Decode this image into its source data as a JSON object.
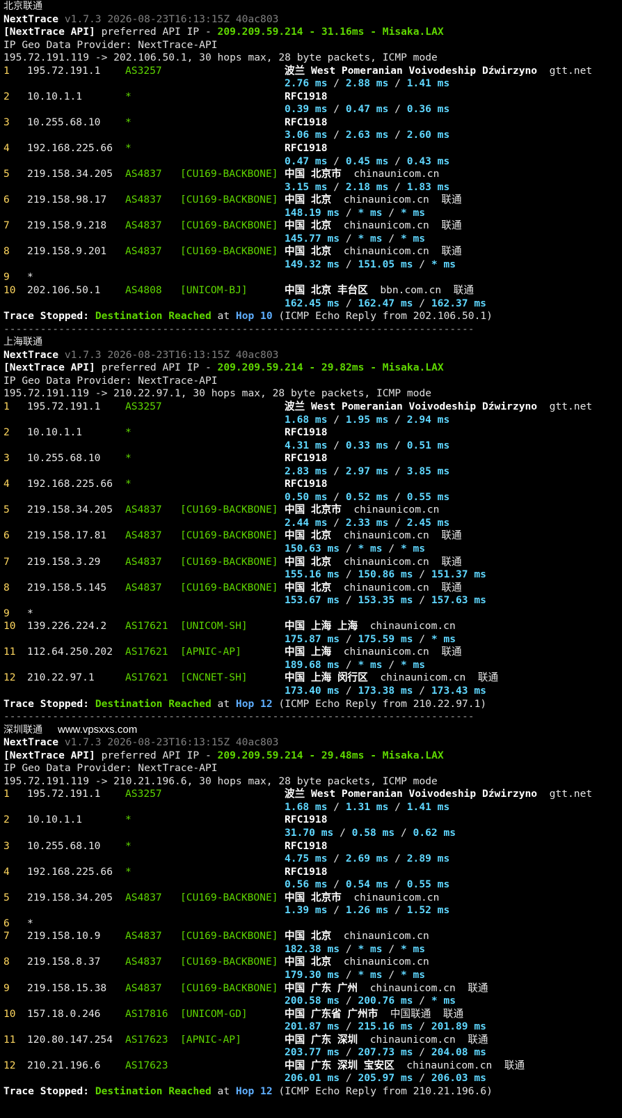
{
  "common": {
    "app_name": "NextTrace",
    "version_line": "v1.7.3 2026-08-23T16:13:15Z 40ac803",
    "api_label": "[NextTrace API]",
    "api_text": " preferred API IP - ",
    "api_ip": "209.209.59.214",
    "dash": " - ",
    "api_node": "Misaka.LAX",
    "geo_provider": "IP Geo Data Provider: NextTrace-API",
    "stop_label": "Trace Stopped:",
    "stop_dest": "Destination Reached",
    "stop_at": " at ",
    "divider": "-----------------------------------------------------------------------------",
    "rtt_sep": " / "
  },
  "watermark": "www.vpsxxs.com",
  "sections": [
    {
      "title": "北京联通",
      "latency": "31.16ms",
      "header": "195.72.191.119 -> 202.106.50.1, 30 hops max, 28 byte packets, ICMP mode",
      "hops": [
        {
          "n": "1",
          "ip": "195.72.191.1",
          "asn": "AS3257",
          "tag": "",
          "geo": "波兰 West Pomeranian Voivodeship Dźwirzyno",
          "domain": "gtt.net",
          "isp": "",
          "rtt": [
            "2.76 ms",
            "2.88 ms",
            "1.41 ms"
          ]
        },
        {
          "n": "2",
          "ip": "10.10.1.1",
          "asn": "*",
          "tag": "",
          "geo": "RFC1918",
          "domain": "",
          "isp": "",
          "rtt": [
            "0.39 ms",
            "0.47 ms",
            "0.36 ms"
          ]
        },
        {
          "n": "3",
          "ip": "10.255.68.10",
          "asn": "*",
          "tag": "",
          "geo": "RFC1918",
          "domain": "",
          "isp": "",
          "rtt": [
            "3.06 ms",
            "2.63 ms",
            "2.60 ms"
          ]
        },
        {
          "n": "4",
          "ip": "192.168.225.66",
          "asn": "*",
          "tag": "",
          "geo": "RFC1918",
          "domain": "",
          "isp": "",
          "rtt": [
            "0.47 ms",
            "0.45 ms",
            "0.43 ms"
          ]
        },
        {
          "n": "5",
          "ip": "219.158.34.205",
          "asn": "AS4837",
          "tag": "[CU169-BACKBONE]",
          "geo": "中国 北京市",
          "domain": "chinaunicom.cn",
          "isp": "",
          "rtt": [
            "3.15 ms",
            "2.18 ms",
            "1.83 ms"
          ]
        },
        {
          "n": "6",
          "ip": "219.158.98.17",
          "asn": "AS4837",
          "tag": "[CU169-BACKBONE]",
          "geo": "中国 北京",
          "domain": "chinaunicom.cn",
          "isp": "联通",
          "rtt": [
            "148.19 ms",
            "* ms",
            "* ms"
          ]
        },
        {
          "n": "7",
          "ip": "219.158.9.218",
          "asn": "AS4837",
          "tag": "[CU169-BACKBONE]",
          "geo": "中国 北京",
          "domain": "chinaunicom.cn",
          "isp": "联通",
          "rtt": [
            "145.77 ms",
            "* ms",
            "* ms"
          ]
        },
        {
          "n": "8",
          "ip": "219.158.9.201",
          "asn": "AS4837",
          "tag": "[CU169-BACKBONE]",
          "geo": "中国 北京",
          "domain": "chinaunicom.cn",
          "isp": "联通",
          "rtt": [
            "149.32 ms",
            "151.05 ms",
            "* ms"
          ]
        },
        {
          "n": "9",
          "ip": "*",
          "asn": "",
          "tag": "",
          "geo": "",
          "domain": "",
          "isp": "",
          "rtt": []
        },
        {
          "n": "10",
          "ip": "202.106.50.1",
          "asn": "AS4808",
          "tag": "[UNICOM-BJ]",
          "geo": "中国 北京 丰台区",
          "domain": "bbn.com.cn",
          "isp": "联通",
          "rtt": [
            "162.45 ms",
            "162.47 ms",
            "162.37 ms"
          ]
        }
      ],
      "stop_hop": "Hop 10",
      "stop_tail": " (ICMP Echo Reply from 202.106.50.1)"
    },
    {
      "title": "上海联通",
      "latency": "29.82ms",
      "header": "195.72.191.119 -> 210.22.97.1, 30 hops max, 28 byte packets, ICMP mode",
      "hops": [
        {
          "n": "1",
          "ip": "195.72.191.1",
          "asn": "AS3257",
          "tag": "",
          "geo": "波兰 West Pomeranian Voivodeship Dźwirzyno",
          "domain": "gtt.net",
          "isp": "",
          "rtt": [
            "1.68 ms",
            "1.95 ms",
            "2.94 ms"
          ]
        },
        {
          "n": "2",
          "ip": "10.10.1.1",
          "asn": "*",
          "tag": "",
          "geo": "RFC1918",
          "domain": "",
          "isp": "",
          "rtt": [
            "4.31 ms",
            "0.33 ms",
            "0.51 ms"
          ]
        },
        {
          "n": "3",
          "ip": "10.255.68.10",
          "asn": "*",
          "tag": "",
          "geo": "RFC1918",
          "domain": "",
          "isp": "",
          "rtt": [
            "2.83 ms",
            "2.97 ms",
            "3.85 ms"
          ]
        },
        {
          "n": "4",
          "ip": "192.168.225.66",
          "asn": "*",
          "tag": "",
          "geo": "RFC1918",
          "domain": "",
          "isp": "",
          "rtt": [
            "0.50 ms",
            "0.52 ms",
            "0.55 ms"
          ]
        },
        {
          "n": "5",
          "ip": "219.158.34.205",
          "asn": "AS4837",
          "tag": "[CU169-BACKBONE]",
          "geo": "中国 北京市",
          "domain": "chinaunicom.cn",
          "isp": "",
          "rtt": [
            "2.44 ms",
            "2.33 ms",
            "2.45 ms"
          ]
        },
        {
          "n": "6",
          "ip": "219.158.17.81",
          "asn": "AS4837",
          "tag": "[CU169-BACKBONE]",
          "geo": "中国 北京",
          "domain": "chinaunicom.cn",
          "isp": "联通",
          "rtt": [
            "150.63 ms",
            "* ms",
            "* ms"
          ]
        },
        {
          "n": "7",
          "ip": "219.158.3.29",
          "asn": "AS4837",
          "tag": "[CU169-BACKBONE]",
          "geo": "中国 北京",
          "domain": "chinaunicom.cn",
          "isp": "联通",
          "rtt": [
            "155.16 ms",
            "150.86 ms",
            "151.37 ms"
          ]
        },
        {
          "n": "8",
          "ip": "219.158.5.145",
          "asn": "AS4837",
          "tag": "[CU169-BACKBONE]",
          "geo": "中国 北京",
          "domain": "chinaunicom.cn",
          "isp": "联通",
          "rtt": [
            "153.67 ms",
            "153.35 ms",
            "157.63 ms"
          ]
        },
        {
          "n": "9",
          "ip": "*",
          "asn": "",
          "tag": "",
          "geo": "",
          "domain": "",
          "isp": "",
          "rtt": []
        },
        {
          "n": "10",
          "ip": "139.226.224.2",
          "asn": "AS17621",
          "tag": "[UNICOM-SH]",
          "geo": "中国 上海 上海",
          "domain": "chinaunicom.cn",
          "isp": "",
          "rtt": [
            "175.87 ms",
            "175.59 ms",
            "* ms"
          ]
        },
        {
          "n": "11",
          "ip": "112.64.250.202",
          "asn": "AS17621",
          "tag": "[APNIC-AP]",
          "geo": "中国 上海",
          "domain": "chinaunicom.cn",
          "isp": "联通",
          "rtt": [
            "189.68 ms",
            "* ms",
            "* ms"
          ]
        },
        {
          "n": "12",
          "ip": "210.22.97.1",
          "asn": "AS17621",
          "tag": "[CNCNET-SH]",
          "geo": "中国 上海 闵行区",
          "domain": "chinaunicom.cn",
          "isp": "联通",
          "rtt": [
            "173.40 ms",
            "173.38 ms",
            "173.43 ms"
          ]
        }
      ],
      "stop_hop": "Hop 12",
      "stop_tail": " (ICMP Echo Reply from 210.22.97.1)"
    },
    {
      "title": "深圳联通",
      "latency": "29.48ms",
      "header": "195.72.191.119 -> 210.21.196.6, 30 hops max, 28 byte packets, ICMP mode",
      "hops": [
        {
          "n": "1",
          "ip": "195.72.191.1",
          "asn": "AS3257",
          "tag": "",
          "geo": "波兰 West Pomeranian Voivodeship Dźwirzyno",
          "domain": "gtt.net",
          "isp": "",
          "rtt": [
            "1.68 ms",
            "1.31 ms",
            "1.41 ms"
          ]
        },
        {
          "n": "2",
          "ip": "10.10.1.1",
          "asn": "*",
          "tag": "",
          "geo": "RFC1918",
          "domain": "",
          "isp": "",
          "rtt": [
            "31.70 ms",
            "0.58 ms",
            "0.62 ms"
          ]
        },
        {
          "n": "3",
          "ip": "10.255.68.10",
          "asn": "*",
          "tag": "",
          "geo": "RFC1918",
          "domain": "",
          "isp": "",
          "rtt": [
            "4.75 ms",
            "2.69 ms",
            "2.89 ms"
          ]
        },
        {
          "n": "4",
          "ip": "192.168.225.66",
          "asn": "*",
          "tag": "",
          "geo": "RFC1918",
          "domain": "",
          "isp": "",
          "rtt": [
            "0.56 ms",
            "0.54 ms",
            "0.55 ms"
          ]
        },
        {
          "n": "5",
          "ip": "219.158.34.205",
          "asn": "AS4837",
          "tag": "[CU169-BACKBONE]",
          "geo": "中国 北京市",
          "domain": "chinaunicom.cn",
          "isp": "",
          "rtt": [
            "1.39 ms",
            "1.26 ms",
            "1.52 ms"
          ]
        },
        {
          "n": "6",
          "ip": "*",
          "asn": "",
          "tag": "",
          "geo": "",
          "domain": "",
          "isp": "",
          "rtt": []
        },
        {
          "n": "7",
          "ip": "219.158.10.9",
          "asn": "AS4837",
          "tag": "[CU169-BACKBONE]",
          "geo": "中国 北京",
          "domain": "chinaunicom.cn",
          "isp": "",
          "rtt": [
            "182.38 ms",
            "* ms",
            "* ms"
          ]
        },
        {
          "n": "8",
          "ip": "219.158.8.37",
          "asn": "AS4837",
          "tag": "[CU169-BACKBONE]",
          "geo": "中国 北京",
          "domain": "chinaunicom.cn",
          "isp": "",
          "rtt": [
            "179.30 ms",
            "* ms",
            "* ms"
          ]
        },
        {
          "n": "9",
          "ip": "219.158.15.38",
          "asn": "AS4837",
          "tag": "[CU169-BACKBONE]",
          "geo": "中国 广东 广州",
          "domain": "chinaunicom.cn",
          "isp": "联通",
          "rtt": [
            "200.58 ms",
            "200.76 ms",
            "* ms"
          ]
        },
        {
          "n": "10",
          "ip": "157.18.0.246",
          "asn": "AS17816",
          "tag": "[UNICOM-GD]",
          "geo": "中国 广东省 广州市",
          "domain": "中国联通",
          "isp": "联通",
          "rtt": [
            "201.87 ms",
            "215.16 ms",
            "201.89 ms"
          ]
        },
        {
          "n": "11",
          "ip": "120.80.147.254",
          "asn": "AS17623",
          "tag": "[APNIC-AP]",
          "geo": "中国 广东 深圳",
          "domain": "chinaunicom.cn",
          "isp": "联通",
          "rtt": [
            "203.77 ms",
            "207.73 ms",
            "204.08 ms"
          ]
        },
        {
          "n": "12",
          "ip": "210.21.196.6",
          "asn": "AS17623",
          "tag": "",
          "geo": "中国 广东 深圳 宝安区",
          "domain": "chinaunicom.cn",
          "isp": "联通",
          "rtt": [
            "206.01 ms",
            "205.97 ms",
            "206.03 ms"
          ]
        }
      ],
      "stop_hop": "Hop 12",
      "stop_tail": " (ICMP Echo Reply from 210.21.196.6)"
    }
  ]
}
